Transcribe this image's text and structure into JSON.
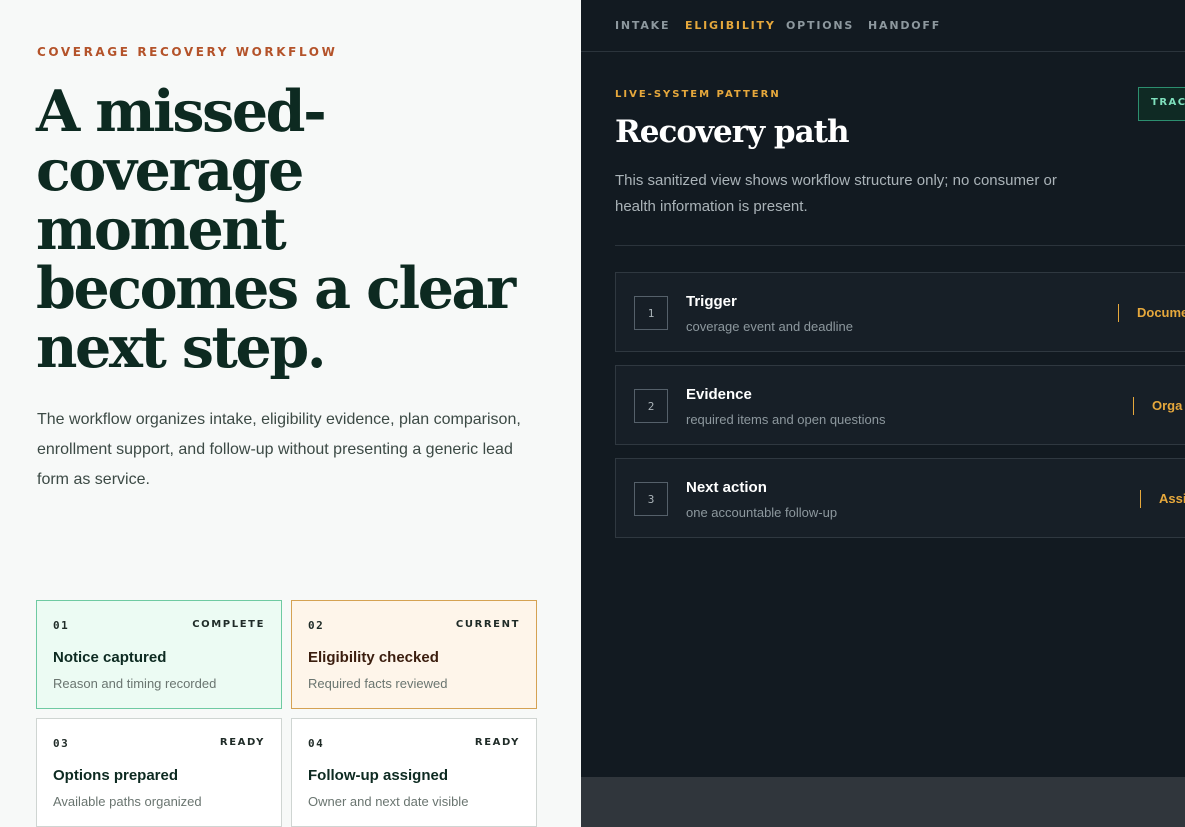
{
  "left": {
    "eyebrow": "COVERAGE RECOVERY WORKFLOW",
    "headline": "A missed-coverage moment becomes a clear next step.",
    "intro": "The workflow organizes intake, eligibility evidence, plan comparison, enrollment support, and follow-up without presenting a generic lead form as service.",
    "cards": [
      {
        "num": "01",
        "state": "COMPLETE",
        "title": "Notice captured",
        "subtitle": "Reason and timing recorded"
      },
      {
        "num": "02",
        "state": "CURRENT",
        "title": "Eligibility checked",
        "subtitle": "Required facts reviewed"
      },
      {
        "num": "03",
        "state": "READY",
        "title": "Options prepared",
        "subtitle": "Available paths organized"
      },
      {
        "num": "04",
        "state": "READY",
        "title": "Follow-up assigned",
        "subtitle": "Owner and next date visible"
      }
    ]
  },
  "right": {
    "nav": [
      "INTAKE",
      "ELIGIBILITY",
      "OPTIONS",
      "HANDOFF"
    ],
    "active_tab": "ELIGIBILITY",
    "eyebrow": "LIVE-SYSTEM PATTERN",
    "title": "Recovery path",
    "badge": "TRACE",
    "description": "This sanitized view shows workflow structure only; no consumer or health information is present.",
    "steps": [
      {
        "index": "1",
        "title": "Trigger",
        "subtitle": "coverage event and deadline",
        "tag": "Docume"
      },
      {
        "index": "2",
        "title": "Evidence",
        "subtitle": "required items and open questions",
        "tag": "Orga"
      },
      {
        "index": "3",
        "title": "Next action",
        "subtitle": "one accountable follow-up",
        "tag": "Assi"
      }
    ]
  },
  "colors": {
    "accent_orange": "#b4532a",
    "accent_amber": "#e6a83c",
    "dark_bg": "#121a21",
    "complete_green": "#6fcaa2",
    "current_amber": "#d5a253"
  }
}
